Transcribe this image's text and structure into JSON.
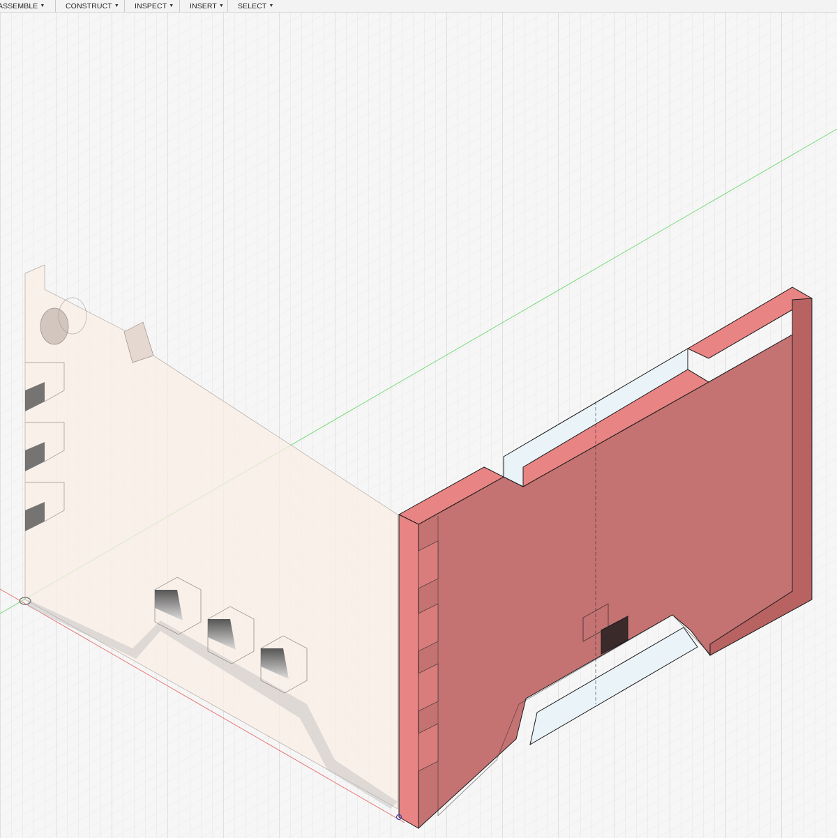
{
  "toolbar": {
    "menus": [
      {
        "id": "assemble",
        "label": "ASSEMBLE"
      },
      {
        "id": "construct",
        "label": "CONSTRUCT"
      },
      {
        "id": "inspect",
        "label": "INSPECT"
      },
      {
        "id": "insert",
        "label": "INSERT"
      },
      {
        "id": "select",
        "label": "SELECT"
      }
    ],
    "dropdown_icon": "caret-down-icon"
  },
  "viewport": {
    "background": "#f6f6f6",
    "grid_minor_color": "#e2e2e2",
    "grid_major_color": "#cfcfcf",
    "x_axis_color": "#e86a6a",
    "y_axis_color": "#6bd66b",
    "selected_face_color": "#c47272",
    "selected_face_top_color": "#e88484",
    "ghost_body_color": "#fbeee6",
    "origin_icon": "origin-point-icon"
  }
}
